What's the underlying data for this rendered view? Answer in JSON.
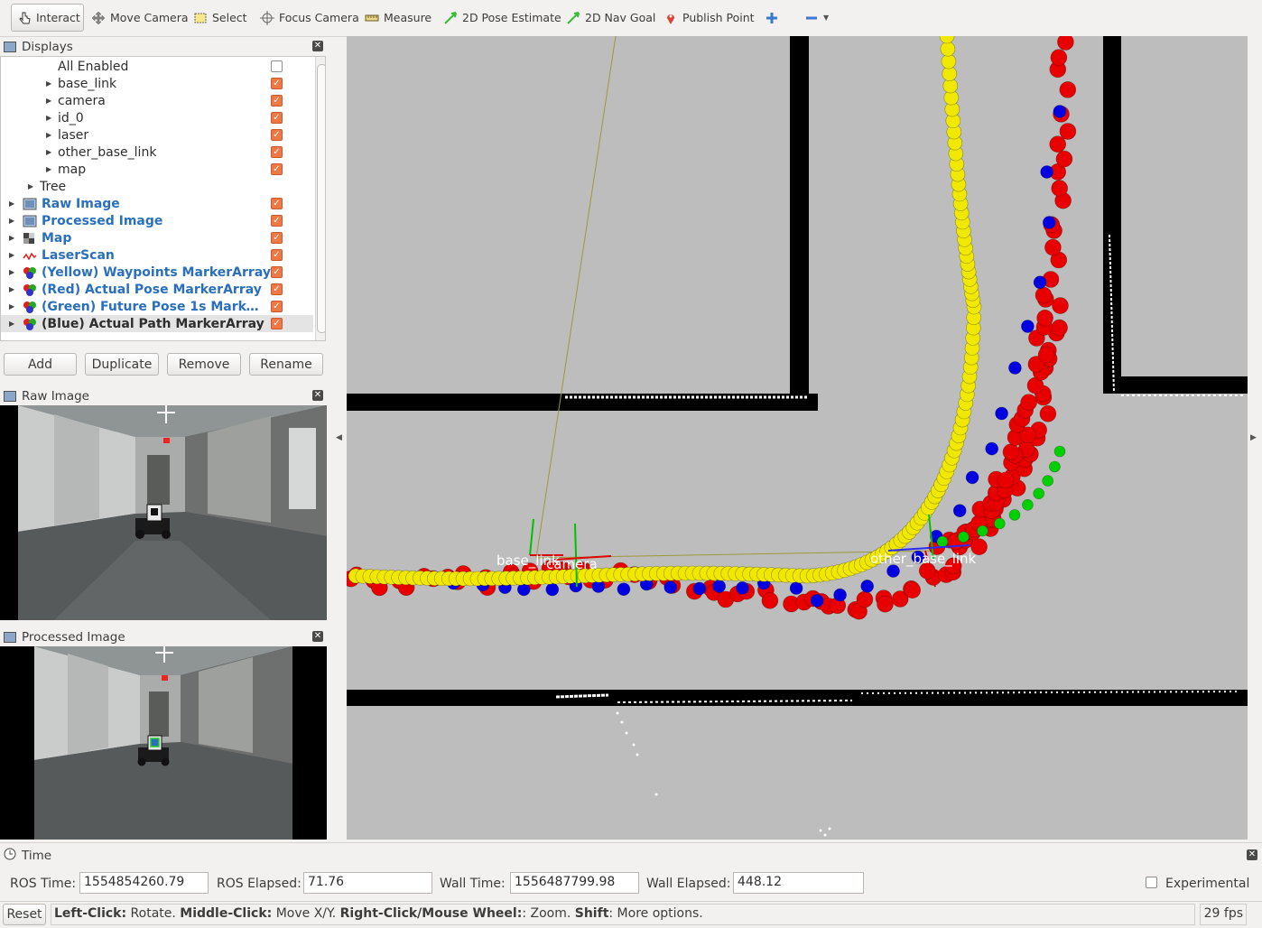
{
  "toolbar": {
    "tools": [
      {
        "label": "Interact",
        "icon": "cursor-hand-icon",
        "active": true
      },
      {
        "label": "Move Camera",
        "icon": "move-camera-icon"
      },
      {
        "label": "Select",
        "icon": "select-box-icon"
      },
      {
        "label": "Focus Camera",
        "icon": "crosshair-icon"
      },
      {
        "label": "Measure",
        "icon": "ruler-icon"
      },
      {
        "label": "2D Pose Estimate",
        "icon": "green-arrow-icon"
      },
      {
        "label": "2D Nav Goal",
        "icon": "green-arrow-icon"
      },
      {
        "label": "Publish Point",
        "icon": "map-pin-icon"
      }
    ],
    "add_icon": "plus-icon",
    "remove_icon": "minus-icon"
  },
  "displays": {
    "title": "Displays",
    "rows": [
      {
        "label": "All Enabled",
        "checked": false
      },
      {
        "label": "base_link",
        "checked": true
      },
      {
        "label": "camera",
        "checked": true
      },
      {
        "label": "id_0",
        "checked": true
      },
      {
        "label": "laser",
        "checked": true
      },
      {
        "label": "other_base_link",
        "checked": true
      },
      {
        "label": "map",
        "checked": true
      },
      {
        "label": "Tree"
      },
      {
        "label": "Raw Image",
        "checked": true
      },
      {
        "label": "Processed Image",
        "checked": true
      },
      {
        "label": "Map",
        "checked": true
      },
      {
        "label": "LaserScan",
        "checked": true
      },
      {
        "label": "(Yellow) Waypoints MarkerArray",
        "checked": true
      },
      {
        "label": "(Red) Actual Pose MarkerArray",
        "checked": true
      },
      {
        "label": "(Green) Future Pose 1s MarkerArray",
        "checked": true
      },
      {
        "label": "(Blue) Actual Path MarkerArray",
        "checked": true
      }
    ],
    "buttons": {
      "add": "Add",
      "duplicate": "Duplicate",
      "remove": "Remove",
      "rename": "Rename"
    }
  },
  "raw_image": {
    "title": "Raw Image"
  },
  "processed_image": {
    "title": "Processed Image"
  },
  "view3d": {
    "frame_labels": {
      "base_link": "base_link",
      "camera": "camera",
      "other": "other_base_link"
    },
    "colors": {
      "waypoints": "#f0e800",
      "actual_pose": "#e80000",
      "future_pose": "#00d000",
      "actual_path": "#0000e0",
      "wall": "#000000",
      "floor": "#bdbdbd"
    }
  },
  "time": {
    "title": "Time",
    "ros_time_label": "ROS Time:",
    "ros_time": "1554854260.79",
    "ros_elapsed_label": "ROS Elapsed:",
    "ros_elapsed": "71.76",
    "wall_time_label": "Wall Time:",
    "wall_time": "1556487799.98",
    "wall_elapsed_label": "Wall Elapsed:",
    "wall_elapsed": "448.12",
    "experimental_label": "Experimental",
    "experimental": false
  },
  "status": {
    "reset_label": "Reset",
    "hint_b1": "Left-Click:",
    "hint_t1": " Rotate. ",
    "hint_b2": "Middle-Click:",
    "hint_t2": " Move X/Y. ",
    "hint_b3": "Right-Click/Mouse Wheel:",
    "hint_t3": ": Zoom. ",
    "hint_b4": "Shift",
    "hint_t4": ": More options.",
    "fps": "29 fps"
  }
}
